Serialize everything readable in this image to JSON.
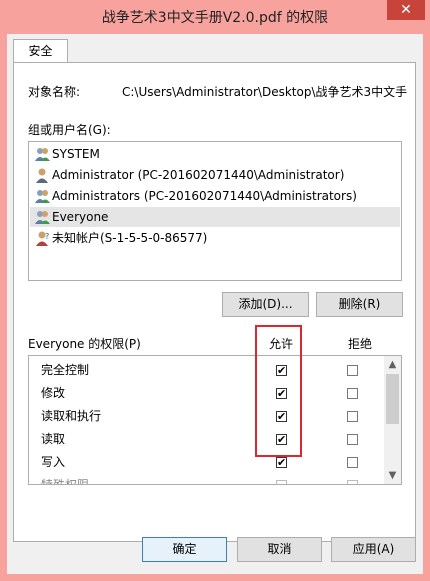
{
  "window": {
    "title": "战争艺术3中文手册V2.0.pdf 的权限",
    "close_glyph": "✕"
  },
  "tabs": [
    {
      "label": "安全"
    }
  ],
  "object": {
    "label": "对象名称:",
    "value": "C:\\Users\\Administrator\\Desktop\\战争艺术3中文手"
  },
  "groups": {
    "label": "组或用户名(G):",
    "users": [
      {
        "name": "SYSTEM",
        "icon": "group-icon",
        "selected": false
      },
      {
        "name": "Administrator (PC-201602071440\\Administrator)",
        "icon": "user-icon",
        "selected": false
      },
      {
        "name": "Administrators (PC-201602071440\\Administrators)",
        "icon": "group-icon",
        "selected": false
      },
      {
        "name": "Everyone",
        "icon": "group-icon",
        "selected": true
      },
      {
        "name": "未知帐户(S-1-5-5-0-86577)",
        "icon": "unknown-user-icon",
        "selected": false
      }
    ]
  },
  "buttons": {
    "add": "添加(D)...",
    "remove": "删除(R)",
    "ok": "确定",
    "cancel": "取消",
    "apply": "应用(A)"
  },
  "permissions": {
    "label": "Everyone 的权限(P)",
    "allow_header": "允许",
    "deny_header": "拒绝",
    "rows": [
      {
        "name": "完全控制",
        "allow": true,
        "deny": false
      },
      {
        "name": "修改",
        "allow": true,
        "deny": false
      },
      {
        "name": "读取和执行",
        "allow": true,
        "deny": false
      },
      {
        "name": "读取",
        "allow": true,
        "deny": false
      },
      {
        "name": "写入",
        "allow": true,
        "deny": false
      },
      {
        "name": "特殊权限",
        "allow": false,
        "deny": false
      }
    ]
  },
  "colors": {
    "title_bar": "#f7a29d",
    "close_button": "#c7443b",
    "highlight_box": "#d9282f"
  },
  "check_glyph": "✔"
}
